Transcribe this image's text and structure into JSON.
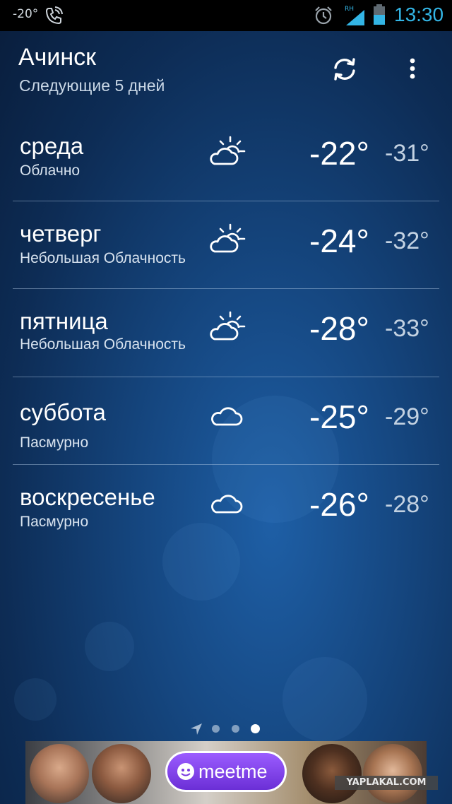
{
  "status_bar": {
    "weather_temp": "-20°",
    "time": "13:30",
    "network_label": "RH",
    "icons": [
      "phone-call-icon",
      "alarm-clock-icon",
      "signal-icon",
      "battery-icon"
    ],
    "time_color": "#33b5e5"
  },
  "header": {
    "city": "Ачинск",
    "subtitle": "Следующие 5 дней",
    "actions": [
      "refresh-icon",
      "overflow-menu-icon"
    ]
  },
  "forecast": [
    {
      "day": "среда",
      "condition": "Облачно",
      "icon": "partly-cloudy-icon",
      "high": "-22°",
      "low": "-31°"
    },
    {
      "day": "четверг",
      "condition": "Небольшая Облачность",
      "icon": "partly-cloudy-icon",
      "high": "-24°",
      "low": "-32°"
    },
    {
      "day": "пятница",
      "condition": "Небольшая Облачность",
      "icon": "partly-cloudy-icon",
      "high": "-28°",
      "low": "-33°"
    },
    {
      "day": "суббота",
      "condition": "Пасмурно",
      "icon": "cloud-icon",
      "high": "-25°",
      "low": "-29°"
    },
    {
      "day": "воскресенье",
      "condition": "Пасмурно",
      "icon": "cloud-icon",
      "high": "-26°",
      "low": "-28°"
    }
  ],
  "pager": {
    "pages": 3,
    "active_page": 3,
    "first_icon": "location-arrow-icon"
  },
  "ad": {
    "brand": "meetme",
    "icon": "meetme-logo-icon"
  },
  "watermark": "YAPLAKAL.COM"
}
